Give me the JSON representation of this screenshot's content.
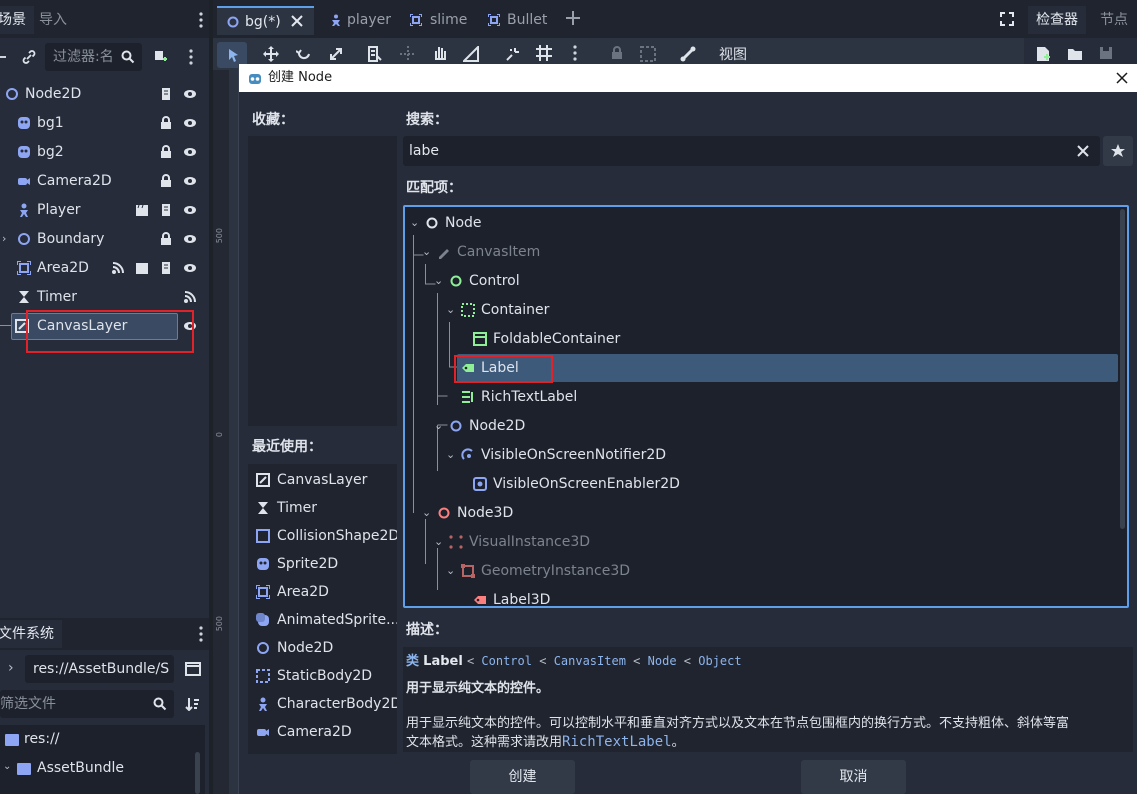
{
  "left_dock": {
    "tabs": [
      {
        "label": "场景",
        "active": true
      },
      {
        "label": "导入",
        "active": false
      }
    ],
    "filter_placeholder": "过滤器:名",
    "scene_tree": [
      {
        "label": "Node2D",
        "icon": "node2d-icon"
      },
      {
        "label": "bg1",
        "icon": "sprite2d-icon"
      },
      {
        "label": "bg2",
        "icon": "sprite2d-icon"
      },
      {
        "label": "Camera2D",
        "icon": "camera2d-icon"
      },
      {
        "label": "Player",
        "icon": "characterbody2d-icon"
      },
      {
        "label": "Boundary",
        "icon": "node2d-icon"
      },
      {
        "label": "Area2D",
        "icon": "area2d-icon"
      },
      {
        "label": "Timer",
        "icon": "timer-icon"
      },
      {
        "label": "CanvasLayer",
        "icon": "canvaslayer-icon",
        "editing": true
      }
    ],
    "filesystem": {
      "tab": "文件系统",
      "path": "res://AssetBundle/S",
      "filter_placeholder": "筛选文件",
      "items": [
        {
          "label": "res://"
        },
        {
          "label": "AssetBundle"
        }
      ]
    }
  },
  "scene_tabs": [
    {
      "label": "bg(*)",
      "active": true
    },
    {
      "label": "player",
      "active": false
    },
    {
      "label": "slime",
      "active": false
    },
    {
      "label": "Bullet",
      "active": false
    }
  ],
  "viewport_toolbar": {
    "view_label": "视图"
  },
  "ruler_labels": [
    "500",
    "0",
    "500"
  ],
  "right_dock": {
    "tabs": [
      {
        "label": "检查器",
        "active": true
      },
      {
        "label": "节点",
        "active": false
      }
    ]
  },
  "dialog": {
    "title": "创建 Node",
    "favorites_label": "收藏：",
    "recent_label": "最近使用：",
    "search_label": "搜索：",
    "search_value": "labe",
    "matches_label": "匹配项：",
    "description_label": "描述：",
    "recent": [
      {
        "label": "CanvasLayer",
        "icon": "canvaslayer-icon"
      },
      {
        "label": "Timer",
        "icon": "timer-icon"
      },
      {
        "label": "CollisionShape2D",
        "icon": "collisionshape2d-icon"
      },
      {
        "label": "Sprite2D",
        "icon": "sprite2d-icon"
      },
      {
        "label": "Area2D",
        "icon": "area2d-icon"
      },
      {
        "label": "AnimatedSprite...",
        "icon": "animatedsprite2d-icon"
      },
      {
        "label": "Node2D",
        "icon": "node2d-icon"
      },
      {
        "label": "StaticBody2D",
        "icon": "staticbody2d-icon"
      },
      {
        "label": "CharacterBody2D",
        "icon": "characterbody2d-icon"
      },
      {
        "label": "Camera2D",
        "icon": "camera2d-icon"
      }
    ],
    "matches": [
      {
        "label": "Node",
        "icon": "node-icon",
        "dim": false
      },
      {
        "label": "CanvasItem",
        "icon": "canvasitem-icon",
        "dim": true
      },
      {
        "label": "Control",
        "icon": "control-icon",
        "dim": false
      },
      {
        "label": "Container",
        "icon": "container-icon",
        "dim": false
      },
      {
        "label": "FoldableContainer",
        "icon": "foldablecontainer-icon",
        "dim": false
      },
      {
        "label": "Label",
        "icon": "label-icon",
        "dim": false,
        "selected": true
      },
      {
        "label": "RichTextLabel",
        "icon": "richtextlabel-icon",
        "dim": false
      },
      {
        "label": "Node2D",
        "icon": "node2d-icon",
        "dim": false
      },
      {
        "label": "VisibleOnScreenNotifier2D",
        "icon": "visibleonscreennotifier2d-icon",
        "dim": false
      },
      {
        "label": "VisibleOnScreenEnabler2D",
        "icon": "visibleonscreenenabler2d-icon",
        "dim": false
      },
      {
        "label": "Node3D",
        "icon": "node3d-icon",
        "dim": false
      },
      {
        "label": "VisualInstance3D",
        "icon": "visualinstance3d-icon",
        "dim": true
      },
      {
        "label": "GeometryInstance3D",
        "icon": "geometryinstance3d-icon",
        "dim": true
      },
      {
        "label": "Label3D",
        "icon": "label3d-icon",
        "dim": false
      }
    ],
    "description": {
      "kind": "类",
      "class_name": "Label",
      "inheritance": [
        "Control",
        "CanvasItem",
        "Node",
        "Object"
      ],
      "brief": "用于显示纯文本的控件。",
      "full_1": "用于显示纯文本的控件。可以控制水平和垂直对齐方式以及文本在节点包围框内的换行方式。不支持粗体、斜体等富",
      "full_2": "文本格式。这种需求请改用",
      "link": "RichTextLabel",
      "full_3": "。"
    },
    "create_button": "创建",
    "cancel_button": "取消"
  },
  "colors": {
    "accent": "#5f9ee8",
    "selection": "#3d5a7a",
    "highlight_box": "#e0222a",
    "node2d": "#8da5f3",
    "control": "#8eef97",
    "node3d": "#fc7f7f"
  }
}
